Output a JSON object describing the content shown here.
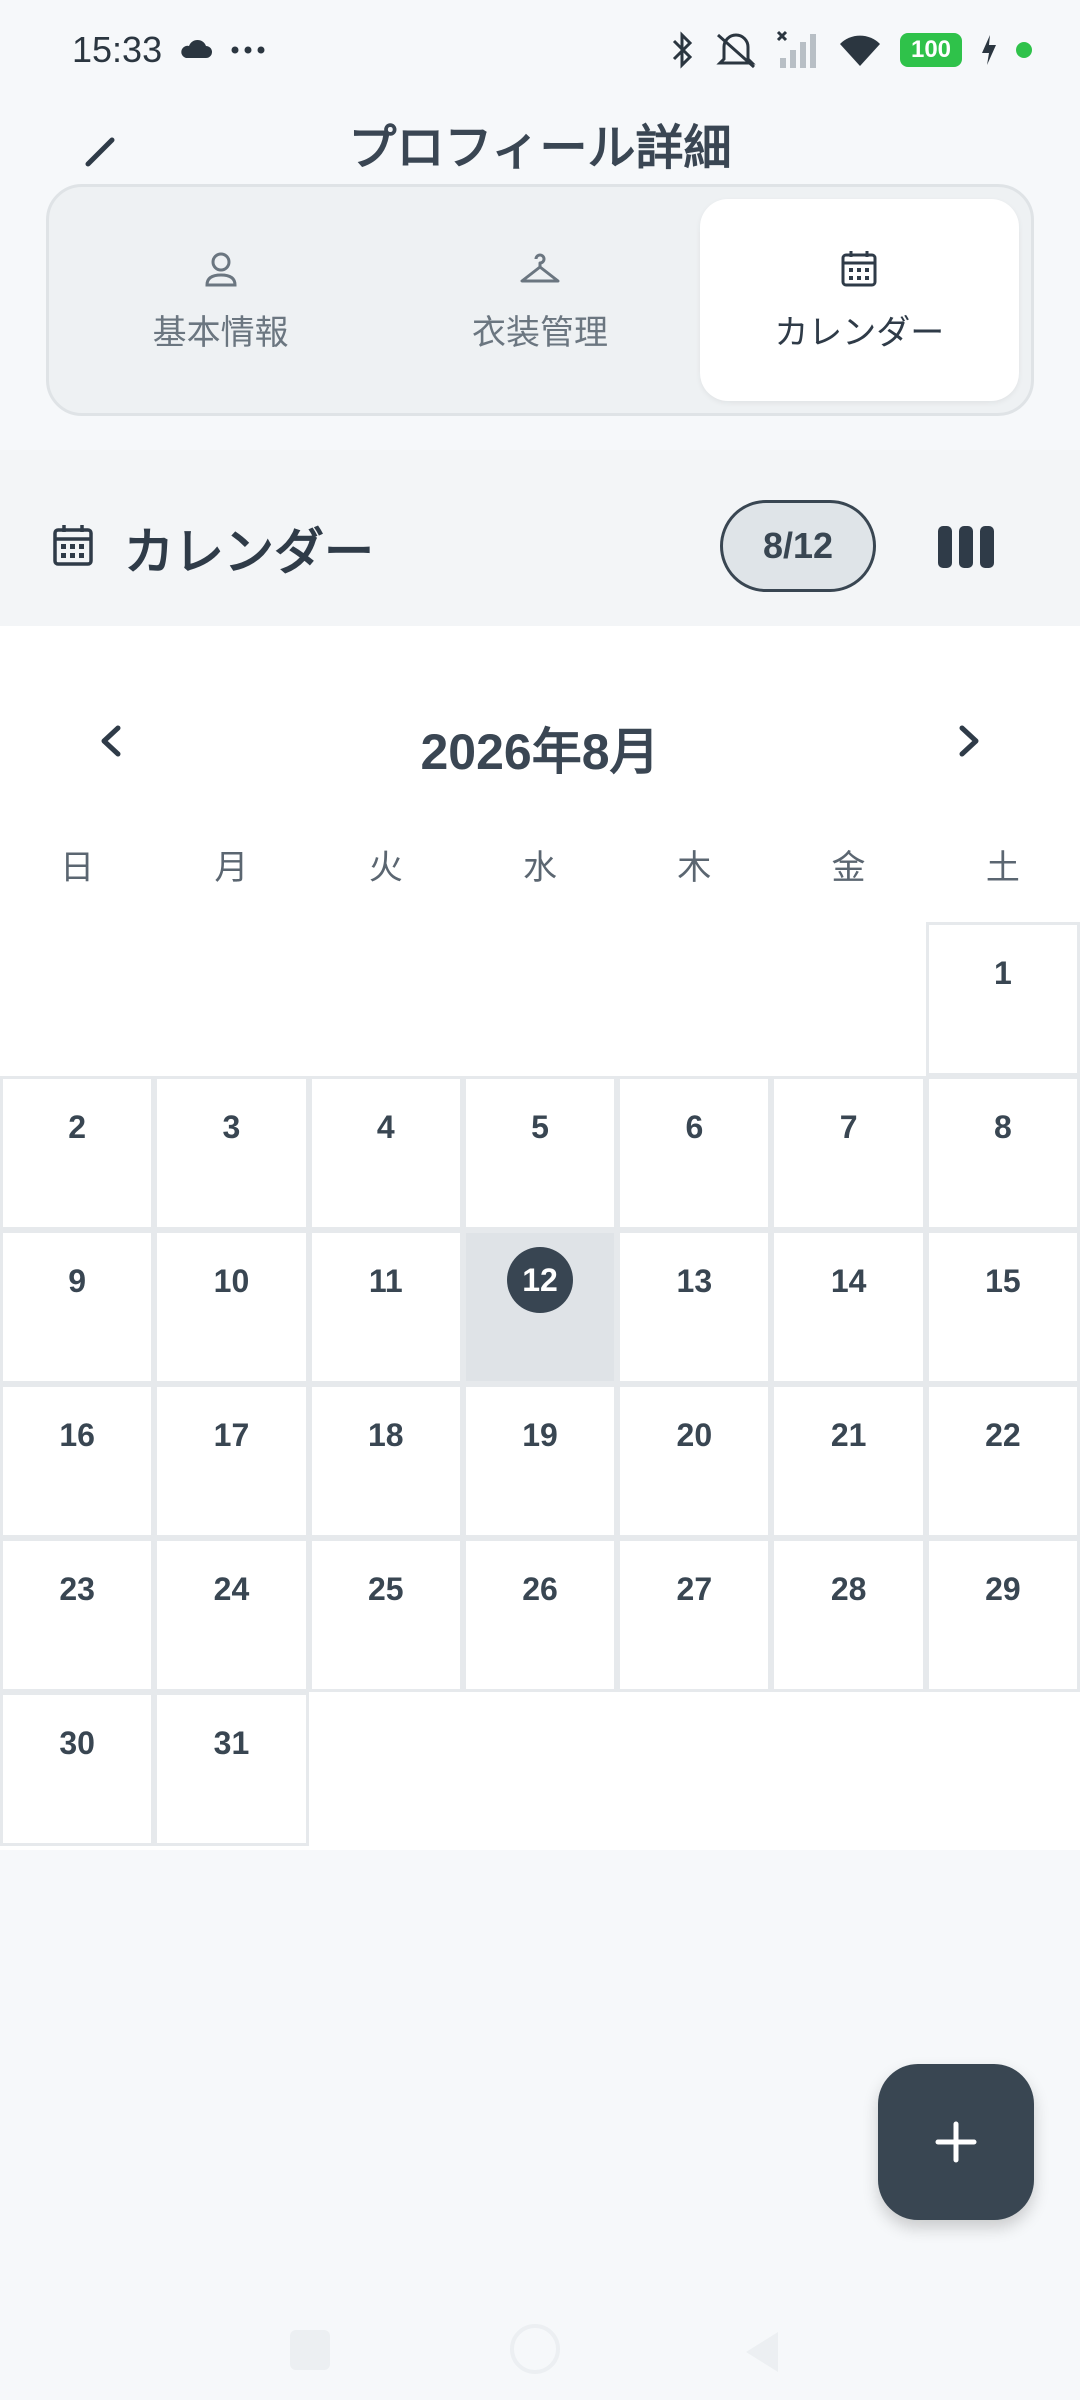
{
  "status_bar": {
    "time": "15:33",
    "battery": "100",
    "icons": [
      "cloud-icon",
      "more-icon",
      "bluetooth-icon",
      "mute-icon",
      "signal-icon",
      "wifi-icon",
      "charging-icon"
    ]
  },
  "header": {
    "title": "プロフィール詳細"
  },
  "tabs": [
    {
      "label": "基本情報",
      "icon": "person-icon",
      "active": false
    },
    {
      "label": "衣装管理",
      "icon": "hanger-icon",
      "active": false
    },
    {
      "label": "カレンダー",
      "icon": "calendar-icon",
      "active": true
    }
  ],
  "section": {
    "title": "カレンダー",
    "date_pill": "8/12"
  },
  "calendar": {
    "month_title": "2026年8月",
    "weekdays": [
      "日",
      "月",
      "火",
      "水",
      "木",
      "金",
      "土"
    ],
    "selected_day": "12",
    "days": [
      "",
      "",
      "",
      "",
      "",
      "",
      "1",
      "2",
      "3",
      "4",
      "5",
      "6",
      "7",
      "8",
      "9",
      "10",
      "11",
      "12",
      "13",
      "14",
      "15",
      "16",
      "17",
      "18",
      "19",
      "20",
      "21",
      "22",
      "23",
      "24",
      "25",
      "26",
      "27",
      "28",
      "29",
      "30",
      "31",
      "",
      "",
      "",
      "",
      ""
    ]
  },
  "colors": {
    "accent": "#394652",
    "background": "#f6f8fa",
    "battery": "#2fc24a"
  }
}
